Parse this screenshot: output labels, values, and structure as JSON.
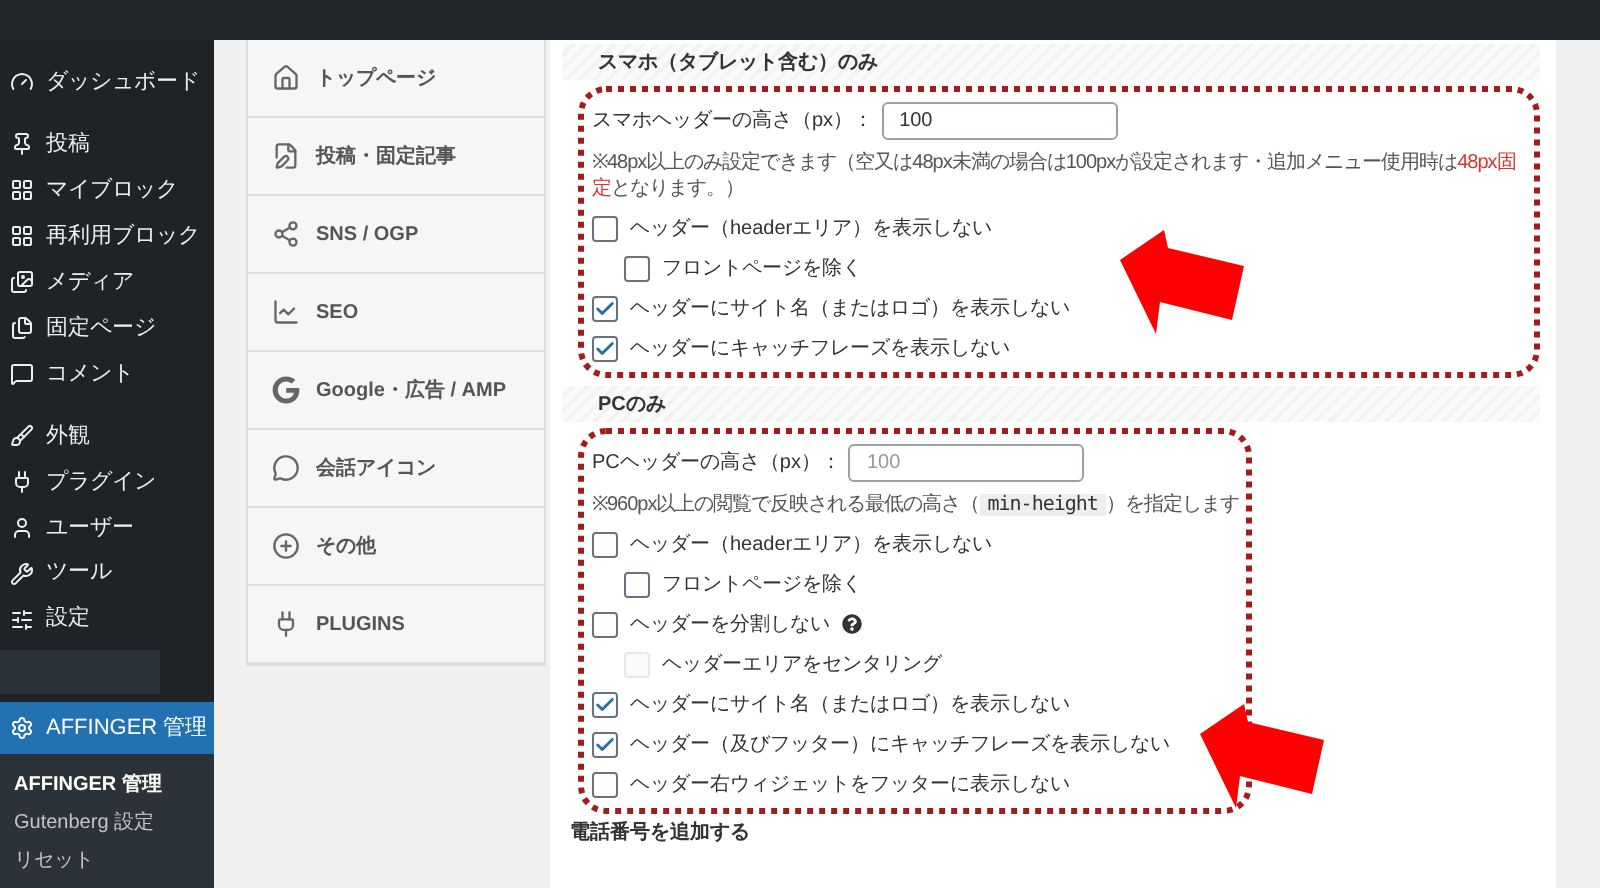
{
  "sidebar": {
    "items": [
      {
        "label": "ダッシュボード",
        "selected": false
      },
      {
        "label": "投稿",
        "selected": false
      },
      {
        "label": "マイブロック",
        "selected": false
      },
      {
        "label": "再利用ブロック",
        "selected": false
      },
      {
        "label": "メディア",
        "selected": false
      },
      {
        "label": "固定ページ",
        "selected": false
      },
      {
        "label": "コメント",
        "selected": false
      },
      {
        "label": "外観",
        "selected": false
      },
      {
        "label": "プラグイン",
        "selected": false
      },
      {
        "label": "ユーザー",
        "selected": false
      },
      {
        "label": "ツール",
        "selected": false
      },
      {
        "label": "設定",
        "selected": false
      },
      {
        "label": "AFFINGER 管理",
        "selected": true
      }
    ],
    "submenu": [
      {
        "label": "AFFINGER 管理",
        "selected": true
      },
      {
        "label": "Gutenberg 設定",
        "selected": false
      },
      {
        "label": "リセット",
        "selected": false
      }
    ]
  },
  "settings_menu": [
    {
      "label": "トップページ"
    },
    {
      "label": "投稿・固定記事"
    },
    {
      "label": "SNS / OGP"
    },
    {
      "label": "SEO"
    },
    {
      "label": "Google・広告 / AMP"
    },
    {
      "label": "会話アイコン"
    },
    {
      "label": "その他"
    },
    {
      "label": "PLUGINS"
    }
  ],
  "sections": [
    {
      "title": "スマホ（タブレット含む）のみ",
      "field": {
        "label": "スマホヘッダーの高さ（px）：",
        "value": "100"
      },
      "note": [
        {
          "kind": "plain",
          "text": "※48px以上のみ設定できます（空又は48px未満の場合は100pxが設定されます・追加メニュー使用時は"
        },
        {
          "kind": "red",
          "text": "48px固定"
        },
        {
          "kind": "plain",
          "text": "となります。）"
        }
      ],
      "options": [
        {
          "label": "ヘッダー（headerエリア）を表示しない",
          "checked": false,
          "disabled": false,
          "help": false,
          "children": [
            {
              "label": "フロントページを除く",
              "checked": false,
              "disabled": false,
              "help": false
            }
          ]
        },
        {
          "label": "ヘッダーにサイト名（またはロゴ）を表示しない",
          "checked": true,
          "disabled": false,
          "help": false
        },
        {
          "label": "ヘッダーにキャッチフレーズを表示しない",
          "checked": true,
          "disabled": false,
          "help": false
        }
      ]
    },
    {
      "title": "PCのみ",
      "field": {
        "label": "PCヘッダーの高さ（px）：",
        "placeholder": "100"
      },
      "note": [
        {
          "kind": "plain",
          "text": "※960px以上の閲覧で反映される最低の高さ（"
        },
        {
          "kind": "code",
          "text": "min-height"
        },
        {
          "kind": "plain",
          "text": "）を指定します"
        }
      ],
      "options": [
        {
          "label": "ヘッダー（headerエリア）を表示しない",
          "checked": false,
          "disabled": false,
          "help": false,
          "children": [
            {
              "label": "フロントページを除く",
              "checked": false,
              "disabled": false,
              "help": false
            }
          ]
        },
        {
          "label": "ヘッダーを分割しない",
          "checked": false,
          "disabled": false,
          "help": true,
          "children": [
            {
              "label": "ヘッダーエリアをセンタリング",
              "checked": false,
              "disabled": true,
              "help": false
            }
          ]
        },
        {
          "label": "ヘッダーにサイト名（またはロゴ）を表示しない",
          "checked": true,
          "disabled": false,
          "help": false
        },
        {
          "label": "ヘッダー（及びフッター）にキャッチフレーズを表示しない",
          "checked": true,
          "disabled": false,
          "help": false
        },
        {
          "label": "ヘッダー右ウィジェットをフッターに表示しない",
          "checked": false,
          "disabled": false,
          "help": false
        }
      ]
    }
  ],
  "next_section": {
    "title": "電話番号を追加する"
  }
}
